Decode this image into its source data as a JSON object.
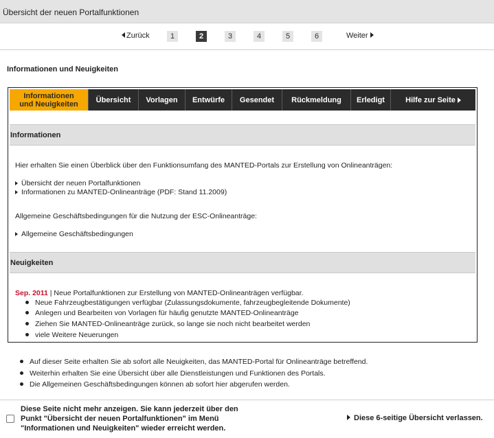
{
  "header": {
    "title": "Übersicht der neuen Portalfunktionen"
  },
  "pager": {
    "prev_label": "Zurück",
    "next_label": "Weiter",
    "pages": [
      "1",
      "2",
      "3",
      "4",
      "5",
      "6"
    ],
    "active_page": "2"
  },
  "section_title": "Informationen und Neuigkeiten",
  "nav": {
    "items": [
      {
        "label": "Informationen und Neuigkeiten",
        "active": true
      },
      {
        "label": "Übersicht"
      },
      {
        "label": "Vorlagen"
      },
      {
        "label": "Entwürfe"
      },
      {
        "label": "Gesendet"
      },
      {
        "label": "Rückmeldung"
      },
      {
        "label": "Erledigt"
      },
      {
        "label": "Hilfe zur Seite"
      }
    ]
  },
  "info": {
    "heading": "Informationen",
    "intro": "Hier erhalten Sie einen Überblick über den Funktionsumfang des MANTED-Portals zur Erstellung von Onlineanträgen:",
    "links": [
      "Übersicht der neuen Portalfunktionen",
      "Informationen zu MANTED-Onlineanträge (PDF: Stand 11.2009)"
    ],
    "terms_intro": "Allgemeine Geschäftsbedingungen für die Nutzung der ESC-Onlineanträge:",
    "terms_link": "Allgemeine Geschäftsbedingungen"
  },
  "news": {
    "heading": "Neuigkeiten",
    "date": "Sep. 2011",
    "headline": " | Neue Portalfunktionen zur Erstellung von MANTED-Onlineanträgen verfügbar.",
    "items": [
      "Neue Fahrzeugbestätigungen verfügbar (Zulassungsdokumente, fahrzeugbegleitende Dokumente)",
      "Anlegen und Bearbeiten von Vorlagen für häufig genutzte MANTED-Onlineanträge",
      "Ziehen Sie MANTED-Onlineanträge zurück, so lange sie noch nicht bearbeitet werden",
      "viele Weitere Neuerungen"
    ]
  },
  "notes": [
    "Auf dieser Seite erhalten Sie ab sofort alle Neuigkeiten, das MANTED-Portal für Onlineanträge betreffend.",
    "Weiterhin erhalten Sie eine Übersicht über alle Dienstleistungen und Funktionen des Portals.",
    "Die Allgemeinen Geschäftsbedingungen können ab sofort hier abgerufen werden."
  ],
  "footer": {
    "checkbox_line1": "Diese Seite nicht mehr anzeigen. Sie kann jederzeit über den",
    "checkbox_line2": "Punkt \"Übersicht der neuen Portalfunktionen\" im Menü",
    "checkbox_line3": "\"Informationen und Neuigkeiten\" wieder erreicht werden.",
    "leave_label": "Diese 6-seitige Übersicht verlassen."
  }
}
